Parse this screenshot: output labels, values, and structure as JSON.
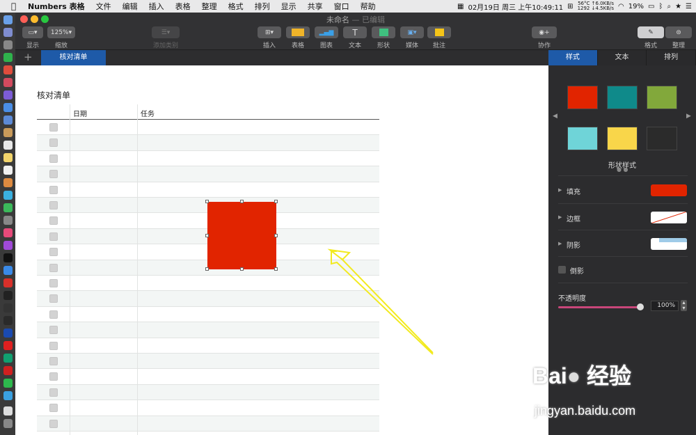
{
  "menubar": {
    "items": [
      "Numbers 表格",
      "文件",
      "编辑",
      "插入",
      "表格",
      "整理",
      "格式",
      "排列",
      "显示",
      "共享",
      "窗口",
      "帮助"
    ],
    "datetime": "02月19日 周三 上午10:49:11",
    "temp": "56°C",
    "fan": "1292",
    "net_up": "↑6.0KB/s",
    "net_down": "↓4.5KB/s",
    "battery": "19%"
  },
  "window": {
    "title": "未命名",
    "status": "— 已编辑"
  },
  "toolbar": {
    "view_label": "显示",
    "zoom_value": "125%",
    "zoom_label": "缩放",
    "add_category_label": "添加类别",
    "insert_label": "插入",
    "table_label": "表格",
    "chart_label": "图表",
    "text_label": "文本",
    "shape_label": "形状",
    "media_label": "媒体",
    "comment_label": "批注",
    "collab_label": "协作",
    "format_label": "格式",
    "organize_label": "整理"
  },
  "sheet": {
    "tab": "核对清单",
    "table_title": "核对清单",
    "col_date": "日期",
    "col_task": "任务"
  },
  "inspector": {
    "tabs": [
      "样式",
      "文本",
      "排列"
    ],
    "swatches": [
      "#e12400",
      "#0f8a8a",
      "#82a83b",
      "#6fd4d8",
      "#f9d64a",
      "#2b2b2b"
    ],
    "shape_styles_label": "形状样式",
    "fill_label": "填充",
    "fill_color": "#e12400",
    "border_label": "边框",
    "shadow_label": "阴影",
    "reflection_label": "倒影",
    "opacity_label": "不透明度",
    "opacity_value": "100%"
  },
  "watermark": {
    "brand": "Bai 经验",
    "url": "jingyan.baidu.com"
  }
}
